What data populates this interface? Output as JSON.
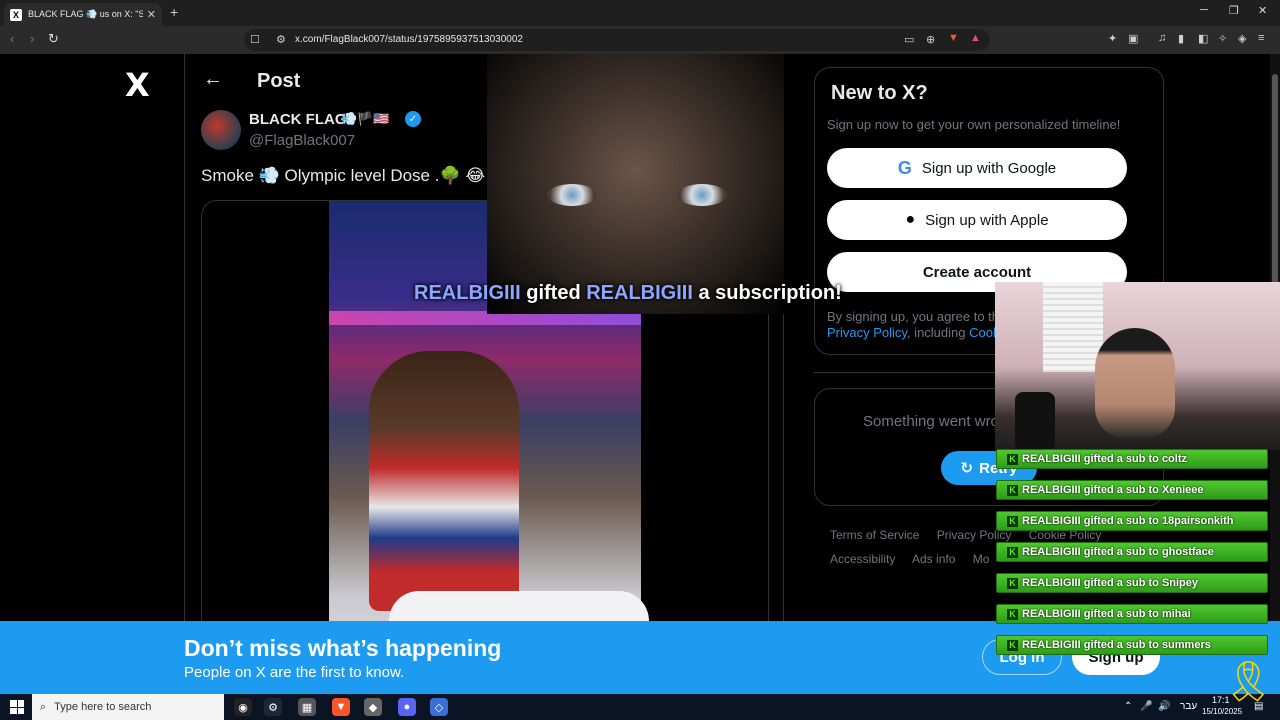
{
  "browser": {
    "tab_title": "BLACK FLAG 💨 us on X: \"Sm",
    "tab_close": "✕",
    "new_tab": "+",
    "url": "x.com/FlagBlack007/status/1975895937513030002",
    "window_controls": {
      "minimize": "─",
      "restore": "❐",
      "close": "✕"
    }
  },
  "sidebar_left": {
    "logo": "X"
  },
  "post": {
    "heading": "Post",
    "author_name": "BLACK FLAG",
    "author_emoji": "💨🏴🇺🇸",
    "author_handle": "@FlagBlack007",
    "text": "Smoke 💨 Olympic level Dose .🌳 😂"
  },
  "signup": {
    "title": "New to X?",
    "subtitle": "Sign up now to get your own personalized timeline!",
    "google_label": "Sign up with Google",
    "apple_label": "Sign up with Apple",
    "create_label": "Create account",
    "legal_prefix": "By signing up, you agree to th",
    "privacy_link": "Privacy Policy",
    "legal_mid": ", including ",
    "cookie_link": "Cook"
  },
  "error_card": {
    "message": "Something went wro",
    "retry_label": "Retry"
  },
  "footer": {
    "row1": [
      "Terms of Service",
      "Privacy Policy",
      "Cookie Policy"
    ],
    "row2": [
      "Accessibility",
      "Ads info",
      "Mo"
    ]
  },
  "banner": {
    "title": "Don’t miss what’s happening",
    "subtitle": "People on X are the first to know.",
    "login_label": "Log in",
    "signup_label": "Sign up"
  },
  "stream": {
    "alert_user1": "REALBIGIII",
    "alert_mid": " gifted ",
    "alert_user2": "REALBIGIII",
    "alert_end": " a subscription!",
    "chat": [
      "REALBIGIII gifted a sub to coltz",
      "REALBIGIII gifted a sub to Xenieee",
      "REALBIGIII gifted a sub to 18pairsonkith",
      "REALBIGIII gifted a sub to ghostface",
      "REALBIGIII gifted a sub to Snipey",
      "REALBIGIII gifted a sub to mihai",
      "REALBIGIII gifted a sub to summers"
    ]
  },
  "taskbar": {
    "search_placeholder": "Type here to search",
    "lang": "עבר",
    "time": "17:1",
    "date": "15/10/2025"
  }
}
